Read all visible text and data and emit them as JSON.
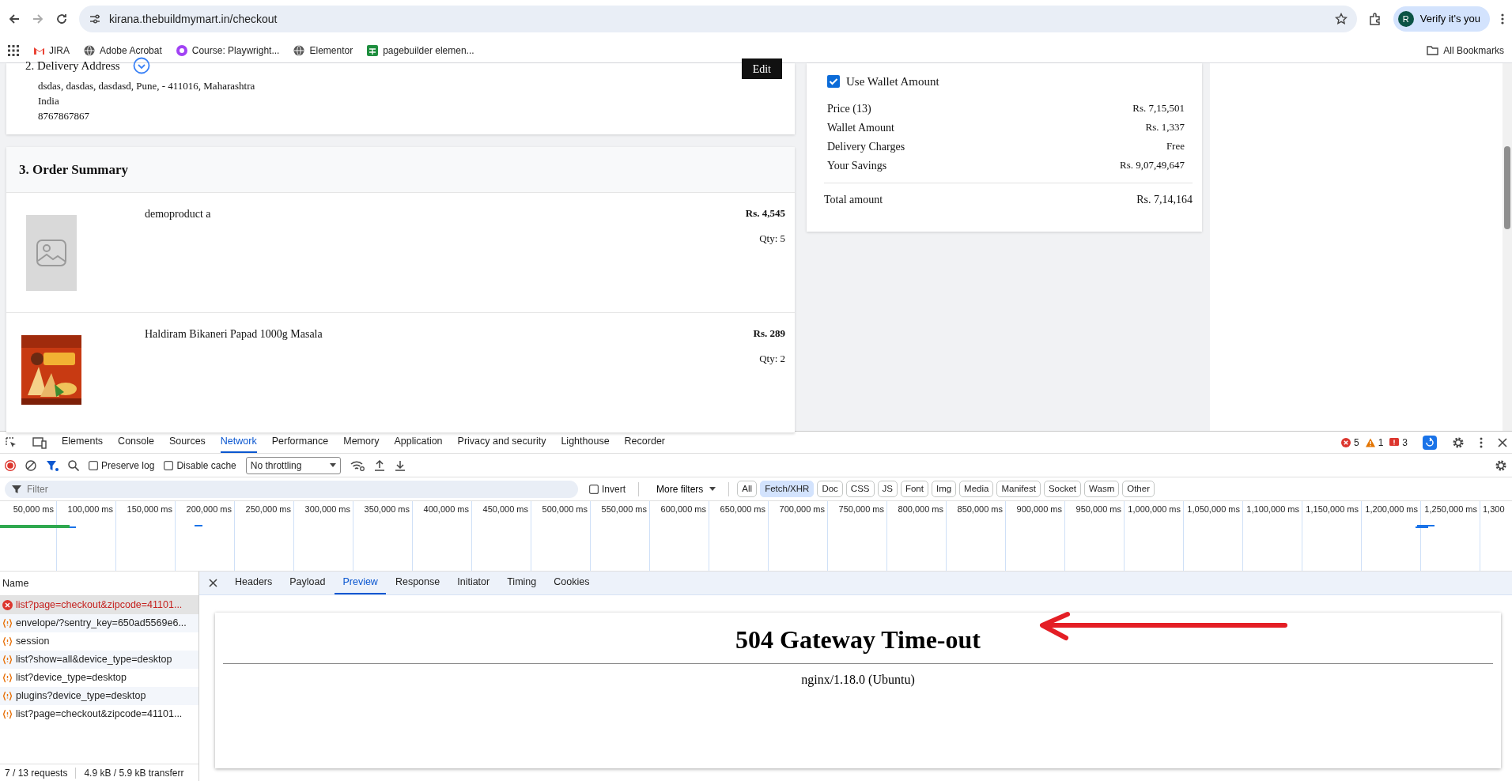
{
  "browser": {
    "url": "kirana.thebuildmymart.in/checkout",
    "profile": {
      "avatar_letter": "R",
      "label": "Verify it's you"
    },
    "bookmarks": [
      {
        "label": "JIRA",
        "kind": "gmail"
      },
      {
        "label": "Adobe Acrobat",
        "kind": "globe"
      },
      {
        "label": "Course: Playwright...",
        "kind": "course"
      },
      {
        "label": "Elementor",
        "kind": "globe"
      },
      {
        "label": "pagebuilder elemen...",
        "kind": "sheet"
      }
    ],
    "all_bookmarks": "All Bookmarks"
  },
  "delivery": {
    "title": "2. Delivery Address",
    "lines": [
      "dsdas, dasdas, dasdasd, Pune, - 411016, Maharashtra",
      "India",
      "8767867867"
    ],
    "edit_button": "Edit"
  },
  "order_summary": {
    "title": "3. Order Summary",
    "items": [
      {
        "name": "demoproduct a",
        "price": "Rs. 4,545",
        "qty": "Qty: 5",
        "kind": "placeholder"
      },
      {
        "name": "Haldiram Bikaneri Papad 1000g Masala",
        "price": "Rs. 289",
        "qty": "Qty: 2"
      }
    ]
  },
  "price_details": {
    "wallet": {
      "label": "Use Wallet Amount",
      "checked": true
    },
    "rows": [
      {
        "label": "Price (13)",
        "value": "Rs. 7,15,501"
      },
      {
        "label": "Wallet Amount",
        "value": "Rs. 1,337"
      },
      {
        "label": "Delivery Charges",
        "value": "Free"
      },
      {
        "label": "Your Savings",
        "value": "Rs. 9,07,49,647"
      }
    ],
    "total": {
      "label": "Total amount",
      "value": "Rs. 7,14,164"
    }
  },
  "devtools": {
    "tabs": [
      {
        "label": "Elements",
        "selected": false
      },
      {
        "label": "Console",
        "selected": false
      },
      {
        "label": "Sources",
        "selected": false
      },
      {
        "label": "Network",
        "selected": true
      },
      {
        "label": "Performance",
        "selected": false
      },
      {
        "label": "Memory",
        "selected": false
      },
      {
        "label": "Application",
        "selected": false
      },
      {
        "label": "Privacy and security",
        "selected": false
      },
      {
        "label": "Lighthouse",
        "selected": false
      },
      {
        "label": "Recorder",
        "selected": false
      }
    ],
    "counts": {
      "errors": "5",
      "warnings": "1",
      "issues": "3"
    },
    "preserve_log": {
      "label": "Preserve log",
      "checked": false
    },
    "disable_cache": {
      "label": "Disable cache",
      "checked": false
    },
    "throttling": "No throttling",
    "filter": {
      "placeholder": "Filter"
    },
    "invert": {
      "label": "Invert",
      "checked": false
    },
    "more_filters": "More filters",
    "type_filters": [
      {
        "label": "All",
        "selected": false
      },
      {
        "label": "Fetch/XHR",
        "selected": true
      },
      {
        "label": "Doc",
        "selected": false
      },
      {
        "label": "CSS",
        "selected": false
      },
      {
        "label": "JS",
        "selected": false
      },
      {
        "label": "Font",
        "selected": false
      },
      {
        "label": "Img",
        "selected": false
      },
      {
        "label": "Media",
        "selected": false
      },
      {
        "label": "Manifest",
        "selected": false
      },
      {
        "label": "Socket",
        "selected": false
      },
      {
        "label": "Wasm",
        "selected": false
      },
      {
        "label": "Other",
        "selected": false
      }
    ],
    "timeline_ticks": [
      "50,000 ms",
      "100,000 ms",
      "150,000 ms",
      "200,000 ms",
      "250,000 ms",
      "300,000 ms",
      "350,000 ms",
      "400,000 ms",
      "450,000 ms",
      "500,000 ms",
      "550,000 ms",
      "600,000 ms",
      "650,000 ms",
      "700,000 ms",
      "750,000 ms",
      "800,000 ms",
      "850,000 ms",
      "900,000 ms",
      "950,000 ms",
      "1,000,000 ms",
      "1,050,000 ms",
      "1,100,000 ms",
      "1,150,000 ms",
      "1,200,000 ms",
      "1,250,000 ms",
      "1,300"
    ],
    "name_header": "Name",
    "requests": [
      {
        "name": "list?page=checkout&zipcode=41101...",
        "error": true,
        "selected": true
      },
      {
        "name": "envelope/?sentry_key=650ad5569e6...",
        "error": false,
        "selected": false
      },
      {
        "name": "session",
        "error": false,
        "selected": false
      },
      {
        "name": "list?show=all&device_type=desktop",
        "error": false,
        "selected": false
      },
      {
        "name": "list?device_type=desktop",
        "error": false,
        "selected": false
      },
      {
        "name": "plugins?device_type=desktop",
        "error": false,
        "selected": false
      },
      {
        "name": "list?page=checkout&zipcode=41101...",
        "error": false,
        "selected": false
      }
    ],
    "detail_tabs": [
      {
        "label": "Headers",
        "selected": false
      },
      {
        "label": "Payload",
        "selected": false
      },
      {
        "label": "Preview",
        "selected": true
      },
      {
        "label": "Response",
        "selected": false
      },
      {
        "label": "Initiator",
        "selected": false
      },
      {
        "label": "Timing",
        "selected": false
      },
      {
        "label": "Cookies",
        "selected": false
      }
    ],
    "preview": {
      "heading": "504 Gateway Time-out",
      "server": "nginx/1.18.0 (Ubuntu)"
    },
    "status": {
      "requests": "7 / 13 requests",
      "transferred": "4.9 kB / 5.9 kB transferr"
    }
  }
}
